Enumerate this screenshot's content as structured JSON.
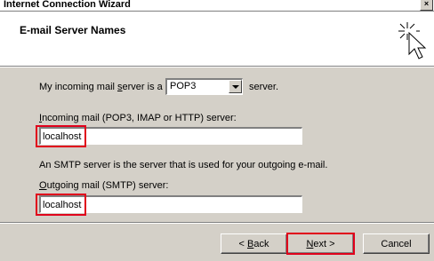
{
  "window": {
    "title": "Internet Connection Wizard",
    "close_glyph": "×"
  },
  "page": {
    "title": "E-mail Server Names"
  },
  "server_type": {
    "label_pre": "My incoming mail ",
    "label_key": "s",
    "label_post": "erver is a",
    "value": "POP3",
    "suffix": "server."
  },
  "incoming": {
    "label_key": "I",
    "label_rest": "ncoming mail (POP3, IMAP or HTTP) server:",
    "value": "localhost"
  },
  "smtp_note": "An SMTP server is the server that is used for your outgoing e-mail.",
  "outgoing": {
    "label_key": "O",
    "label_rest": "utgoing mail (SMTP) server:",
    "value": "localhost"
  },
  "buttons": {
    "back_prefix": "< ",
    "back_key": "B",
    "back_rest": "ack",
    "next_key": "N",
    "next_rest": "ext >",
    "cancel": "Cancel"
  },
  "colors": {
    "highlight": "#e0001b",
    "dialog_bg": "#d4d0c8"
  },
  "icons": {
    "wizard": "wizard-sparkle-cursor-icon"
  }
}
